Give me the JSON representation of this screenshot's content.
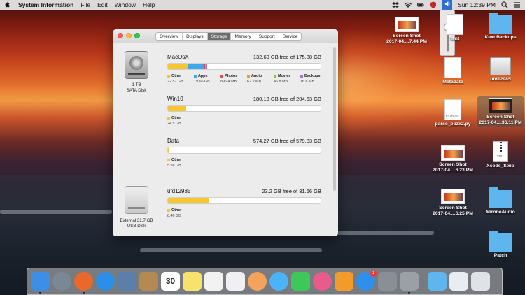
{
  "menubar": {
    "apple": "",
    "app_name": "System Information",
    "menus": [
      "File",
      "Edit",
      "Window",
      "Help"
    ],
    "clock": "Sun 12:39 PM"
  },
  "window": {
    "tabs": [
      "Overview",
      "Displays",
      "Storage",
      "Memory",
      "Support",
      "Service"
    ],
    "active_tab": "Storage",
    "drives": [
      {
        "caption_1": "1 TB",
        "caption_2": "SATA Disk"
      },
      {
        "caption_1": "External 31.7 GB",
        "caption_2": "USB Disk"
      }
    ],
    "volumes": [
      {
        "name": "MacOsX",
        "free": "132.63 GB free of 175.88 GB",
        "segments": [
          {
            "name": "Other",
            "size": "22.57 GB",
            "fraction": 0.1283,
            "color": "#f7c630"
          },
          {
            "name": "Apps",
            "size": "19.66 GB",
            "fraction": 0.1118,
            "color": "#3fa8e8"
          },
          {
            "name": "Photos",
            "size": "896.4 MB",
            "fraction": 0.0051,
            "color": "#e24b4b"
          },
          {
            "name": "Audio",
            "size": "62.2 MB",
            "fraction": 0.0004,
            "color": "#f39c2a"
          },
          {
            "name": "Movies",
            "size": "46.8 MB",
            "fraction": 0.0003,
            "color": "#7ac943"
          },
          {
            "name": "Backups",
            "size": "16.6 MB",
            "fraction": 0.0001,
            "color": "#a772d6"
          }
        ]
      },
      {
        "name": "Win10",
        "free": "180.13 GB free of 204.63 GB",
        "segments": [
          {
            "name": "Other",
            "size": "24.5 GB",
            "fraction": 0.1197,
            "color": "#f7c630"
          }
        ]
      },
      {
        "name": "Data",
        "free": "574.27 GB free of 579.83 GB",
        "segments": [
          {
            "name": "Other",
            "size": "5.56 GB",
            "fraction": 0.0096,
            "color": "#f7c630"
          }
        ]
      },
      {
        "name": "ufd12985",
        "free": "23.2 GB free of 31.66 GB",
        "segments": [
          {
            "name": "Other",
            "size": "8.46 GB",
            "fraction": 0.2672,
            "color": "#f7c630"
          }
        ]
      }
    ]
  },
  "desktop": {
    "icons": [
      {
        "label_1": "Screen Shot",
        "label_2": "2017-04....7.44 PM"
      },
      {
        "label_1": "Kext Backups",
        "label_2": ""
      },
      {
        "label_1": "tent",
        "label_2": ""
      },
      {
        "label_1": "Metadata",
        "label_2": ""
      },
      {
        "label_1": "ufd12985",
        "label_2": ""
      },
      {
        "label_1": "parse_pbzx2.py",
        "label_2": ""
      },
      {
        "label_1": "Screen Shot",
        "label_2": "2017-04....36.11 PM"
      },
      {
        "label_1": "Screen Shot",
        "label_2": "2017-04....6.23 PM"
      },
      {
        "label_1": "Xcode_8.xip",
        "label_2": ""
      },
      {
        "label_1": "Screen Shot",
        "label_2": "2017-04....6.25 PM"
      },
      {
        "label_1": "MironeAudio",
        "label_2": ""
      },
      {
        "label_1": "Patch",
        "label_2": ""
      }
    ],
    "doc_tag": "PYTHON",
    "zip_tag": "XIP"
  },
  "dock": {
    "calendar_day": "30",
    "appstore_badge": "1",
    "colors": {
      "finder": "#3d8fe6",
      "launchpad": "#7a8796",
      "firefox": "#e8692a",
      "safari": "#2b8fe8",
      "preview": "#5b7fa8",
      "contacts": "#b58a52",
      "calendar": "#ffffff",
      "notes": "#f7e36c",
      "reminders": "#f2f2f2",
      "photos_app": "#f0f0f0",
      "photos": "#f5a25a",
      "messages": "#4bb3f7",
      "facetime": "#3ec85a",
      "itunes": "#e95b8b",
      "ibooks": "#f39b2a",
      "appstore": "#2f8fec",
      "syspref": "#8a8f96",
      "sysinfo": "#9aa0a6",
      "downloads": "#5fb6ee",
      "folder": "#e8edf2",
      "trash": "#dfe3e8"
    }
  }
}
